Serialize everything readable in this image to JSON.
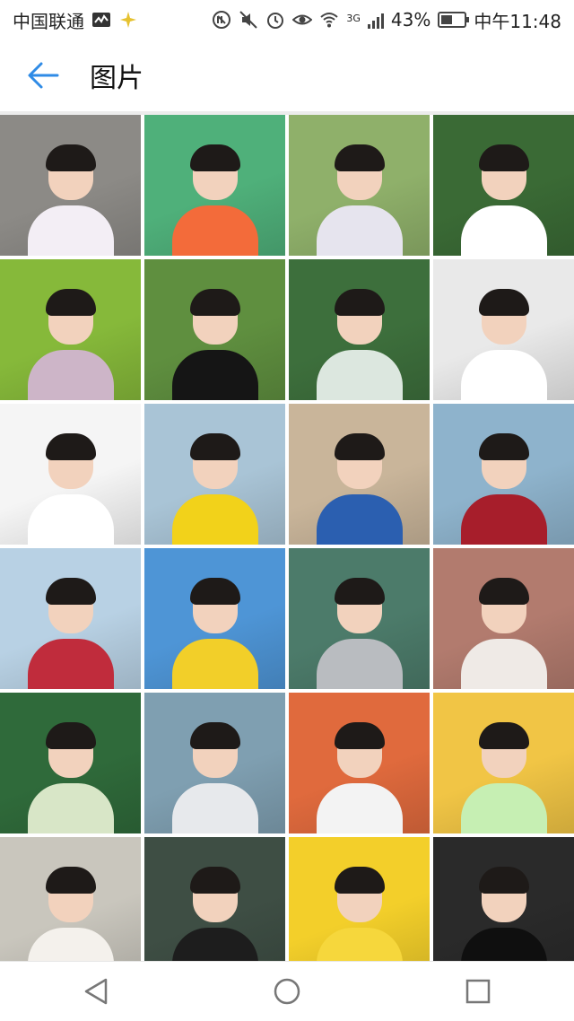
{
  "status_bar": {
    "carrier": "中国联通",
    "battery_percent": "43%",
    "network": "3G",
    "time": "中午11:48"
  },
  "app_bar": {
    "title": "图片"
  },
  "colors": {
    "accent": "#2f8be6",
    "divider": "#ececec"
  },
  "photos": [
    {
      "bg": "#8c8a86",
      "shirt": "#f3eef5"
    },
    {
      "bg": "#4fb07a",
      "shirt": "#f36b3a"
    },
    {
      "bg": "#8fb06a",
      "shirt": "#e6e4ee"
    },
    {
      "bg": "#3a6a35",
      "shirt": "#ffffff"
    },
    {
      "bg": "#86b93a",
      "shirt": "#cdb5c8"
    },
    {
      "bg": "#5f8f3f",
      "shirt": "#151515"
    },
    {
      "bg": "#3d6f3c",
      "shirt": "#dce7df"
    },
    {
      "bg": "#e9e9e9",
      "shirt": "#ffffff"
    },
    {
      "bg": "#f5f5f5",
      "shirt": "#ffffff"
    },
    {
      "bg": "#a9c4d6",
      "shirt": "#f2d21a"
    },
    {
      "bg": "#c9b59a",
      "shirt": "#2b5fb0"
    },
    {
      "bg": "#8eb3cc",
      "shirt": "#a71e2b"
    },
    {
      "bg": "#b8d1e4",
      "shirt": "#c02c3c"
    },
    {
      "bg": "#4e95d6",
      "shirt": "#f2cf29"
    },
    {
      "bg": "#4c7b6a",
      "shirt": "#b9bcc0"
    },
    {
      "bg": "#b27b6e",
      "shirt": "#efeae6"
    },
    {
      "bg": "#2f6a3a",
      "shirt": "#d8e6c7"
    },
    {
      "bg": "#7f9fb1",
      "shirt": "#e7e9ec"
    },
    {
      "bg": "#e06a3d",
      "shirt": "#f3f3f3"
    },
    {
      "bg": "#f1c545",
      "shirt": "#c6efb3"
    },
    {
      "bg": "#c9c6bd",
      "shirt": "#f4f1ec"
    },
    {
      "bg": "#3e4e44",
      "shirt": "#1d1d1d"
    },
    {
      "bg": "#f3cf2a",
      "shirt": "#f6d73c"
    },
    {
      "bg": "#2a2a2a",
      "shirt": "#0f0f0f"
    }
  ]
}
